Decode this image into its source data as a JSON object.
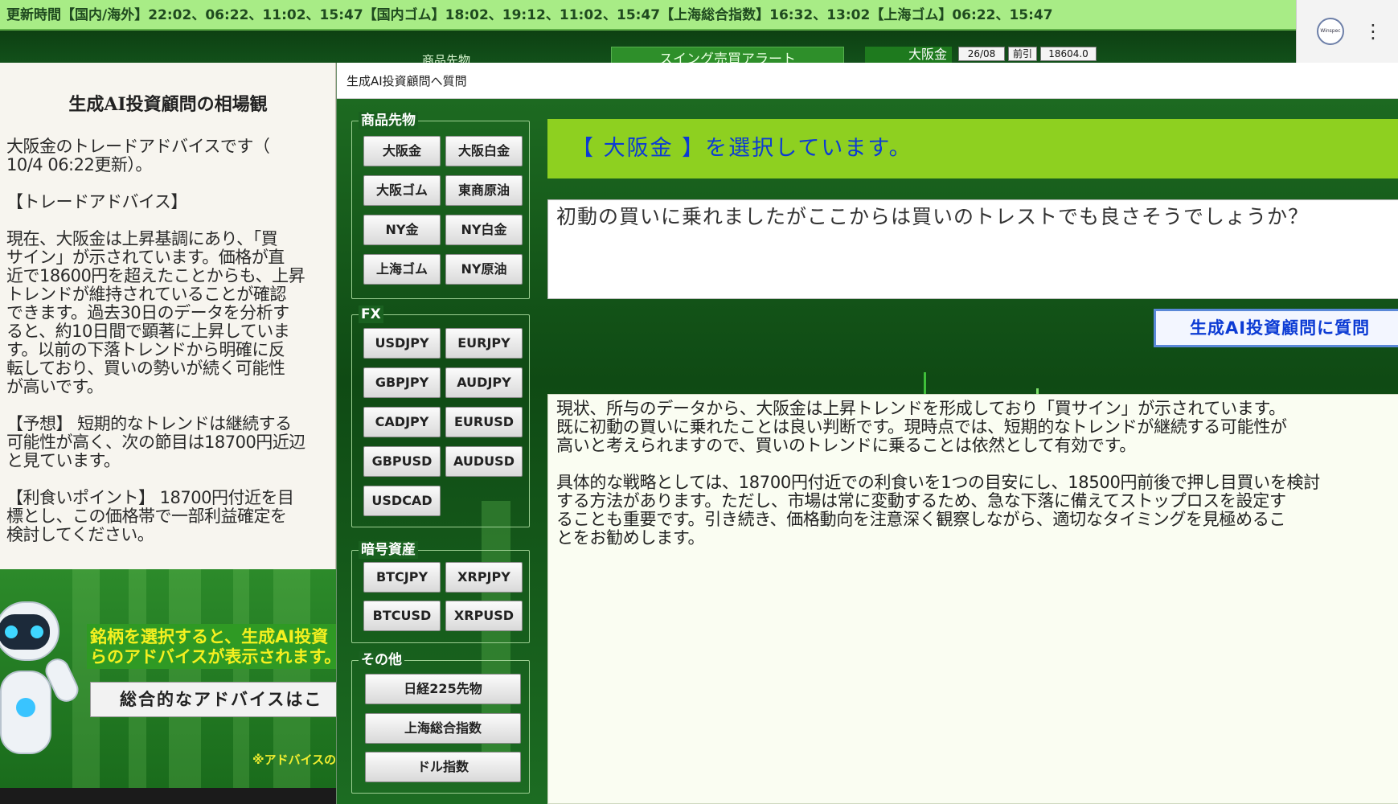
{
  "ticker": {
    "text": "更新時間【国内/海外】22:02、06:22、11:02、15:47【国内ゴム】18:02、19:12、11:02、15:47【上海総合指数】16:32、13:02【上海ゴム】06:22、15:47"
  },
  "browser": {
    "avatar_text": "Winspec",
    "menu_glyph": "⋮"
  },
  "background": {
    "section_label": "商品先物",
    "swing_button": "スイング売買アラート",
    "quote": {
      "name": "大阪金",
      "contract": "26/08",
      "session": "前引",
      "price": "18604.0"
    }
  },
  "left_panel": {
    "title": "生成AI投資顧問の相場観",
    "body": "大阪金のトレードアドバイスです（\n10/4 06:22更新）。\n\n【トレードアドバイス】\n\n現在、大阪金は上昇基調にあり、「買\nサイン」が示されています。価格が直\n近で18600円を超えたことからも、上昇\nトレンドが維持されていることが確認\nできます。過去30日のデータを分析す\nると、約10日間で顕著に上昇していま\nす。以前の下落トレンドから明確に反\n転しており、買いの勢いが続く可能性\nが高いです。\n\n【予想】 短期的なトレンドは継続する\n可能性が高く、次の節目は18700円近辺\nと見ています。\n\n【利食いポイント】 18700円付近を目\n標とし、この価格帯で一部利益確定を\n検討してください。",
    "notice": "銘柄を選択すると、生成AI投資\nらのアドバイスが表示されます。",
    "overall_button": "総合的なアドバイスはこ",
    "note": "※アドバイスの"
  },
  "dialog": {
    "title": "生成AI投資顧問へ質問",
    "groups": {
      "commodities": {
        "label": "商品先物",
        "buttons": [
          "大阪金",
          "大阪白金",
          "大阪ゴム",
          "東商原油",
          "NY金",
          "NY白金",
          "上海ゴム",
          "NY原油"
        ]
      },
      "fx": {
        "label": "FX",
        "buttons": [
          "USDJPY",
          "EURJPY",
          "GBPJPY",
          "AUDJPY",
          "CADJPY",
          "EURUSD",
          "GBPUSD",
          "AUDUSD",
          "USDCAD"
        ]
      },
      "crypto": {
        "label": "暗号資産",
        "buttons": [
          "BTCJPY",
          "XRPJPY",
          "BTCUSD",
          "XRPUSD"
        ]
      },
      "other": {
        "label": "その他",
        "buttons": [
          "日経225先物",
          "上海総合指数",
          "ドル指数"
        ]
      }
    },
    "selected_banner": "【 大阪金 】を選択しています。",
    "question": "初動の買いに乗れましたがここからは買いのトレストでも良さそうでしょうか？",
    "ask_button": "生成AI投資顧問に質問",
    "answer": "現状、所与のデータから、大阪金は上昇トレンドを形成しており「買サイン」が示されています。\n既に初動の買いに乗れたことは良い判断です。現時点では、短期的なトレンドが継続する可能性が\n高いと考えられますので、買いのトレンドに乗ることは依然として有効です。\n\n具体的な戦略としては、18700円付近での利食いを1つの目安にし、18500円前後で押し目買いを検討\nする方法があります。ただし、市場は常に変動するため、急な下落に備えてストップロスを設定す\nることも重要です。引き続き、価格動向を注意深く観察しながら、適切なタイミングを見極めるこ\nとをお勧めします。"
  },
  "colors": {
    "ticker_bg": "#a8ec86",
    "banner_bg": "#8ed020",
    "banner_text": "#0c3bd4",
    "notice_text": "#f5f020",
    "dialog_bg": "#16561b"
  }
}
